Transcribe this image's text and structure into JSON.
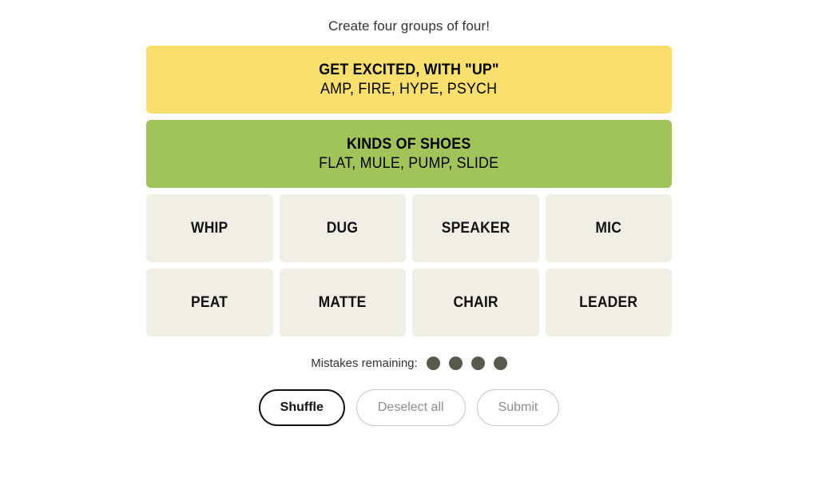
{
  "header": {
    "instruction": "Create four groups of four!"
  },
  "colors": {
    "yellow": "#f9df6d",
    "green": "#a0c35a",
    "tile": "#efefe6",
    "dot": "#5a594e",
    "text": "#121212",
    "muted": "#8c8c8c",
    "page_bg": "#ffffff"
  },
  "board": {
    "solved_groups": [
      {
        "title": "GET EXCITED, WITH \"UP\"",
        "members": "AMP, FIRE, HYPE, PSYCH",
        "color": "#f9df6d",
        "color_name": "yellow"
      },
      {
        "title": "KINDS OF SHOES",
        "members": "FLAT, MULE, PUMP, SLIDE",
        "color": "#a0c35a",
        "color_name": "green"
      }
    ],
    "tile_rows": [
      [
        "WHIP",
        "DUG",
        "SPEAKER",
        "MIC"
      ],
      [
        "PEAT",
        "MATTE",
        "CHAIR",
        "LEADER"
      ]
    ]
  },
  "mistakes": {
    "label": "Mistakes remaining:",
    "remaining": 4,
    "dots": [
      "filled",
      "filled",
      "filled",
      "filled"
    ]
  },
  "controls": {
    "buttons": [
      {
        "label": "Shuffle",
        "state": "active"
      },
      {
        "label": "Deselect all",
        "state": "disabled"
      },
      {
        "label": "Submit",
        "state": "disabled"
      }
    ]
  }
}
